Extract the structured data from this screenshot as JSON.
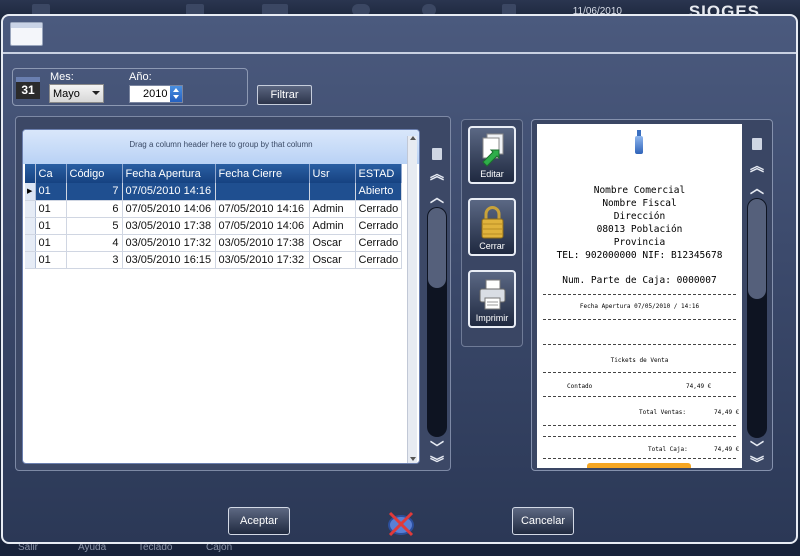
{
  "background_app": {
    "date": "11/06/2010",
    "brand": "SIOGES",
    "bottom_items": [
      "Salir",
      "Ayuda",
      "Teclado",
      "Cajon"
    ]
  },
  "filter": {
    "month_label": "Mes:",
    "month_value": "Mayo",
    "year_label": "Año:",
    "year_value": "2010",
    "calendar_day": "31",
    "filter_button": "Filtrar"
  },
  "grid": {
    "group_hint": "Drag a column header here to group by that column",
    "columns": [
      "Ca",
      "Código",
      "Fecha Apertura",
      "Fecha Cierre",
      "Usr",
      "ESTAD"
    ],
    "rows": [
      {
        "ca": "01",
        "codigo": "7",
        "apertura": "07/05/2010 14:16",
        "cierre": "",
        "usr": "",
        "estado": "Abierto",
        "selected": true
      },
      {
        "ca": "01",
        "codigo": "6",
        "apertura": "07/05/2010 14:06",
        "cierre": "07/05/2010 14:16",
        "usr": "Admin",
        "estado": "Cerrado",
        "selected": false
      },
      {
        "ca": "01",
        "codigo": "5",
        "apertura": "03/05/2010 17:38",
        "cierre": "07/05/2010 14:06",
        "usr": "Admin",
        "estado": "Cerrado",
        "selected": false
      },
      {
        "ca": "01",
        "codigo": "4",
        "apertura": "03/05/2010 17:32",
        "cierre": "03/05/2010 17:38",
        "usr": "Oscar",
        "estado": "Cerrado",
        "selected": false
      },
      {
        "ca": "01",
        "codigo": "3",
        "apertura": "03/05/2010 16:15",
        "cierre": "03/05/2010 17:32",
        "usr": "Oscar",
        "estado": "Cerrado",
        "selected": false
      }
    ]
  },
  "actions": {
    "edit": "Editar",
    "close": "Cerrar",
    "print": "Imprimir"
  },
  "ticket": {
    "business_name": "Nombre Comercial",
    "fiscal_name": "Nombre Fiscal",
    "address": "Dirección",
    "city": "08013 Población",
    "province": "Provincia",
    "phone_nif": "TEL: 902000000 NIF: B12345678",
    "cash_part": "Num. Parte de Caja: 0000007",
    "opening": "Fecha Apertura  07/05/2010 / 14:16",
    "section": "Tickets de Venta",
    "cash_label": "Contado",
    "cash_value": "74,49 €",
    "total_sales_label": "Total Ventas:",
    "total_sales_value": "74,49 €",
    "total_cash_label": "Total Caja:",
    "total_cash_value": "74,49 €"
  },
  "footer": {
    "accept": "Aceptar",
    "cancel": "Cancelar"
  }
}
